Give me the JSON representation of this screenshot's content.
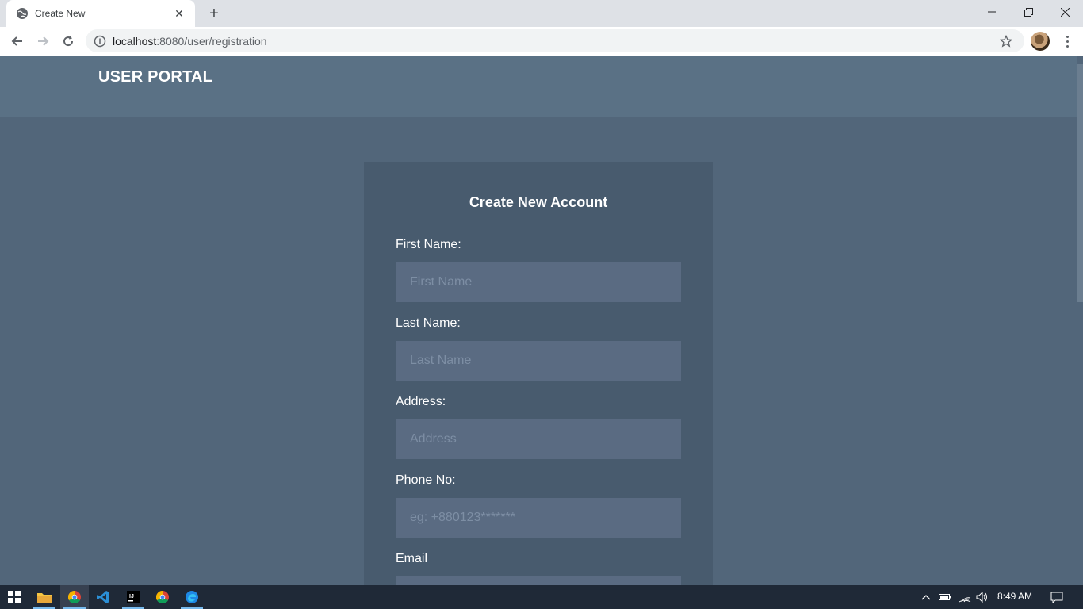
{
  "browser": {
    "tab_title": "Create New",
    "url_host": "localhost",
    "url_rest": ":8080/user/registration"
  },
  "header": {
    "brand": "USER PORTAL"
  },
  "form": {
    "title": "Create New Account",
    "fields": [
      {
        "label": "First Name:",
        "placeholder": "First Name"
      },
      {
        "label": "Last Name:",
        "placeholder": "Last Name"
      },
      {
        "label": "Address:",
        "placeholder": "Address"
      },
      {
        "label": "Phone No:",
        "placeholder": "eg: +880123*******"
      },
      {
        "label": "Email",
        "placeholder": ""
      }
    ]
  },
  "taskbar": {
    "clock": "8:49 AM",
    "apps": [
      "windows-start-icon",
      "file-explorer-icon",
      "chrome-icon",
      "vscode-icon",
      "intellij-icon",
      "chrome-icon",
      "edge-icon"
    ]
  },
  "colors": {
    "page_bg": "#52667a",
    "header_bg": "#5a7185",
    "card_bg": "#485b6e",
    "input_bg": "#5a6b82"
  }
}
